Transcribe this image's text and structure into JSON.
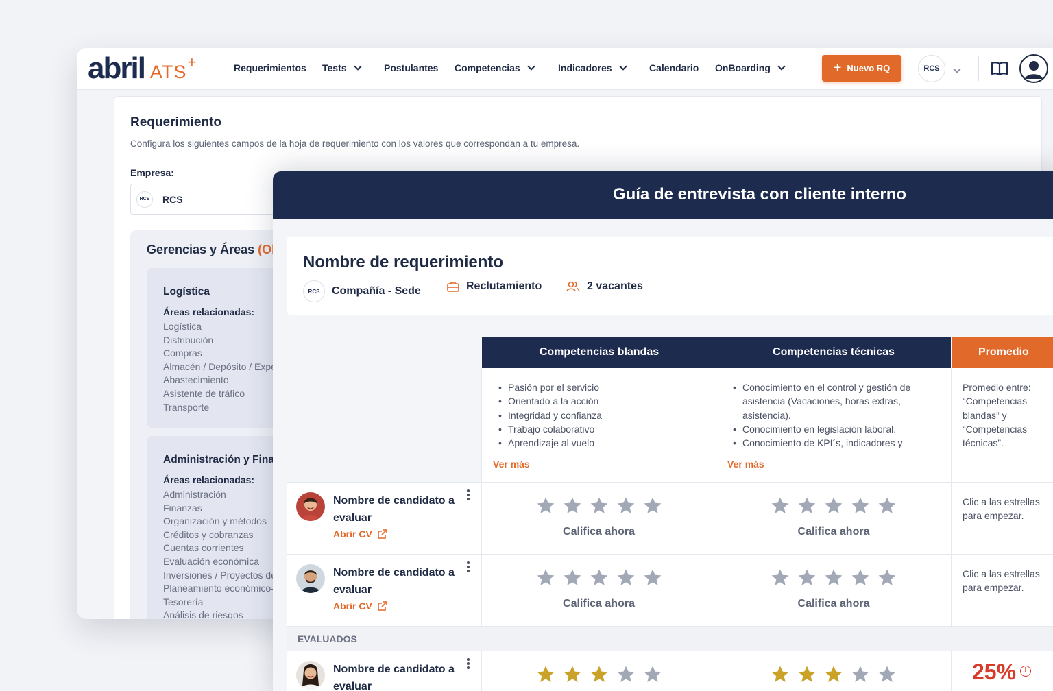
{
  "nav": {
    "logo_main": "abril",
    "logo_ats": "ATS",
    "logo_plus": "+",
    "items": [
      "Requerimientos",
      "Tests",
      "Postulantes",
      "Competencias",
      "Indicadores",
      "Calendario",
      "OnBoarding"
    ],
    "new_button": "Nuevo RQ",
    "company_badge": "RCS"
  },
  "requerimiento": {
    "title": "Requerimiento",
    "subtitle": "Configura los siguientes campos de la hoja de requerimiento con los valores que correspondan a tu empresa.",
    "empresa_label": "Empresa:",
    "empresa_value": "RCS",
    "gerencias_title": "Gerencias y Áreas",
    "gerencias_suffix": "(Ob",
    "areas": [
      {
        "title": "Logística",
        "rel_label": "Áreas relacionadas:",
        "items": [
          "Logística",
          "Distribución",
          "Compras",
          "Almacén / Depósito / Expe",
          "Abastecimiento",
          "Asistente de tráfico",
          "Transporte"
        ]
      },
      {
        "title": "Administración y Fina",
        "rel_label": "Áreas relacionadas:",
        "items": [
          "Administración",
          "Finanzas",
          "Organización y métodos",
          "Créditos y cobranzas",
          "Cuentas corrientes",
          "Evaluación económica",
          "Inversiones / Proyectos de",
          "Planeamiento económico-",
          "Tesorería",
          "Análisis de riesgos"
        ]
      }
    ]
  },
  "guia": {
    "title": "Guía de entrevista con cliente interno",
    "req_name": "Nombre de requerimiento",
    "company_badge": "RCS",
    "company": "Compañía - Sede",
    "area": "Reclutamiento",
    "vacantes": "2 vacantes",
    "columns": {
      "blandas": "Competencias blandas",
      "tecnicas": "Competencias técnicas",
      "promedio": "Promedio"
    },
    "blandas_items": [
      "Pasión por el servicio",
      "Orientado a la acción",
      "Integridad y confianza",
      "Trabajo colaborativo",
      "Aprendizaje al vuelo"
    ],
    "tecnicas_items": [
      "Conocimiento en el control y gestión de asistencia (Vacaciones, horas extras, asistencia).",
      "Conocimiento en legislación laboral.",
      "Conocimiento de KPI´s, indicadores y"
    ],
    "ver_mas": "Ver más",
    "promedio_desc": "Promedio entre: “Competencias blandas” y “Competencias técnicas”.",
    "candidates": [
      {
        "name": "Nombre de candidato a evaluar",
        "cv": "Abrir CV",
        "rate_label": "Califica ahora",
        "promedio_hint": "Clic a las estrellas para empezar.",
        "stars_blandas": 0,
        "stars_tecnicas": 0
      },
      {
        "name": "Nombre de candidato a evaluar",
        "cv": "Abrir CV",
        "rate_label": "Califica ahora",
        "promedio_hint": "Clic a las estrellas para empezar.",
        "stars_blandas": 0,
        "stars_tecnicas": 0
      }
    ],
    "evaluados_label": "EVALUADOS",
    "evaluated": [
      {
        "name": "Nombre de candidato a evaluar",
        "stars_blandas": 3,
        "stars_tecnicas": 3,
        "promedio": "25%",
        "info_icon": "i"
      }
    ]
  },
  "colors": {
    "navy": "#1d2b4f",
    "orange": "#e16a2a",
    "star_empty": "#a3a8b6",
    "star_filled": "#c9a227",
    "danger": "#d93b2b"
  }
}
